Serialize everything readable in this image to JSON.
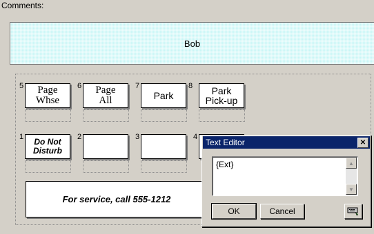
{
  "comments": {
    "label": "Comments:",
    "value": "Bob"
  },
  "keys": [
    {
      "num": "5",
      "label": "Page\nWhse"
    },
    {
      "num": "6",
      "label": "Page\nAll"
    },
    {
      "num": "7",
      "label": "Park"
    },
    {
      "num": "8",
      "label": "Park\nPick-up"
    },
    {
      "num": "1",
      "label": "Do Not\nDisturb"
    },
    {
      "num": "2",
      "label": ""
    },
    {
      "num": "3",
      "label": ""
    },
    {
      "num": "4",
      "label": ""
    }
  ],
  "service_text": "For service, call 555-1212",
  "dialog": {
    "title": "Text Editor",
    "close_icon": "close-x-icon",
    "text": "{Ext}",
    "ok_label": "OK",
    "cancel_label": "Cancel",
    "extra_icon": "keyboard-icon"
  }
}
